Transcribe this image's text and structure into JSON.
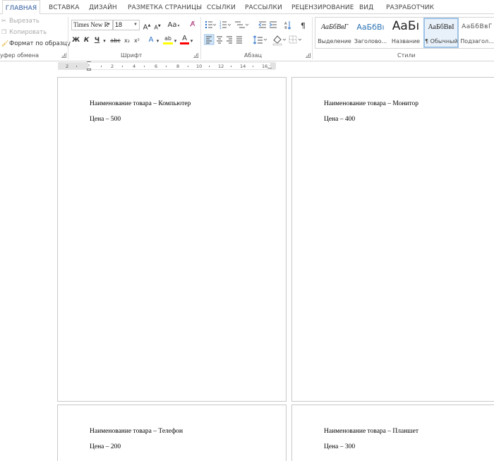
{
  "tabs": [
    {
      "label": "ГЛАВНАЯ",
      "active": true
    },
    {
      "label": "ВСТАВКА"
    },
    {
      "label": "ДИЗАЙН"
    },
    {
      "label": "РАЗМЕТКА СТРАНИЦЫ"
    },
    {
      "label": "ССЫЛКИ"
    },
    {
      "label": "РАССЫЛКИ"
    },
    {
      "label": "РЕЦЕНЗИРОВАНИЕ"
    },
    {
      "label": "ВИД"
    },
    {
      "label": "РАЗРАБОТЧИК"
    }
  ],
  "clipboard": {
    "cut": "Вырезать",
    "copy": "Копировать",
    "format_painter": "Формат по образцу",
    "group_label": "уфер обмена"
  },
  "font": {
    "name": "Times New R",
    "size": "18",
    "grow": "A",
    "shrink": "A",
    "case": "Aa",
    "bold": "Ж",
    "italic": "К",
    "underline": "Ч",
    "strike": "abc",
    "subscript": "x₂",
    "superscript": "x²",
    "effects": "A",
    "highlight": "ab",
    "color": "A",
    "group_label": "Шрифт"
  },
  "paragraph": {
    "pilcrow": "¶",
    "group_label": "Абзац"
  },
  "styles": {
    "items": [
      {
        "sample": "АаБбВвГ",
        "name": "Выделение"
      },
      {
        "sample": "АаБбВı",
        "name": "Заголово..."
      },
      {
        "sample": "АаБı",
        "name": "Название"
      },
      {
        "sample": "АаБбВвI",
        "name": "¶ Обычный"
      },
      {
        "sample": "АаБбВвГ",
        "name": "Подзагол..."
      }
    ],
    "group_label": "Стили"
  },
  "ruler": {
    "numbers": [
      "2",
      "2",
      "4",
      "6",
      "8",
      "10",
      "12",
      "14",
      "16"
    ]
  },
  "pages": [
    {
      "name": "Наименование товара – Компьютер",
      "price": "Цена – 500"
    },
    {
      "name": "Наименование товара – Монитор",
      "price": "Цена – 400"
    },
    {
      "name": "Наименование товара – Телефон",
      "price": "Цена – 200"
    },
    {
      "name": "Наименование товара – Планшет",
      "price": "Цена – 300"
    }
  ],
  "colors": {
    "accent": "#2b579a",
    "highlight": "#ffff00",
    "font_color": "#ff0000",
    "selection": "#cde3f7"
  }
}
